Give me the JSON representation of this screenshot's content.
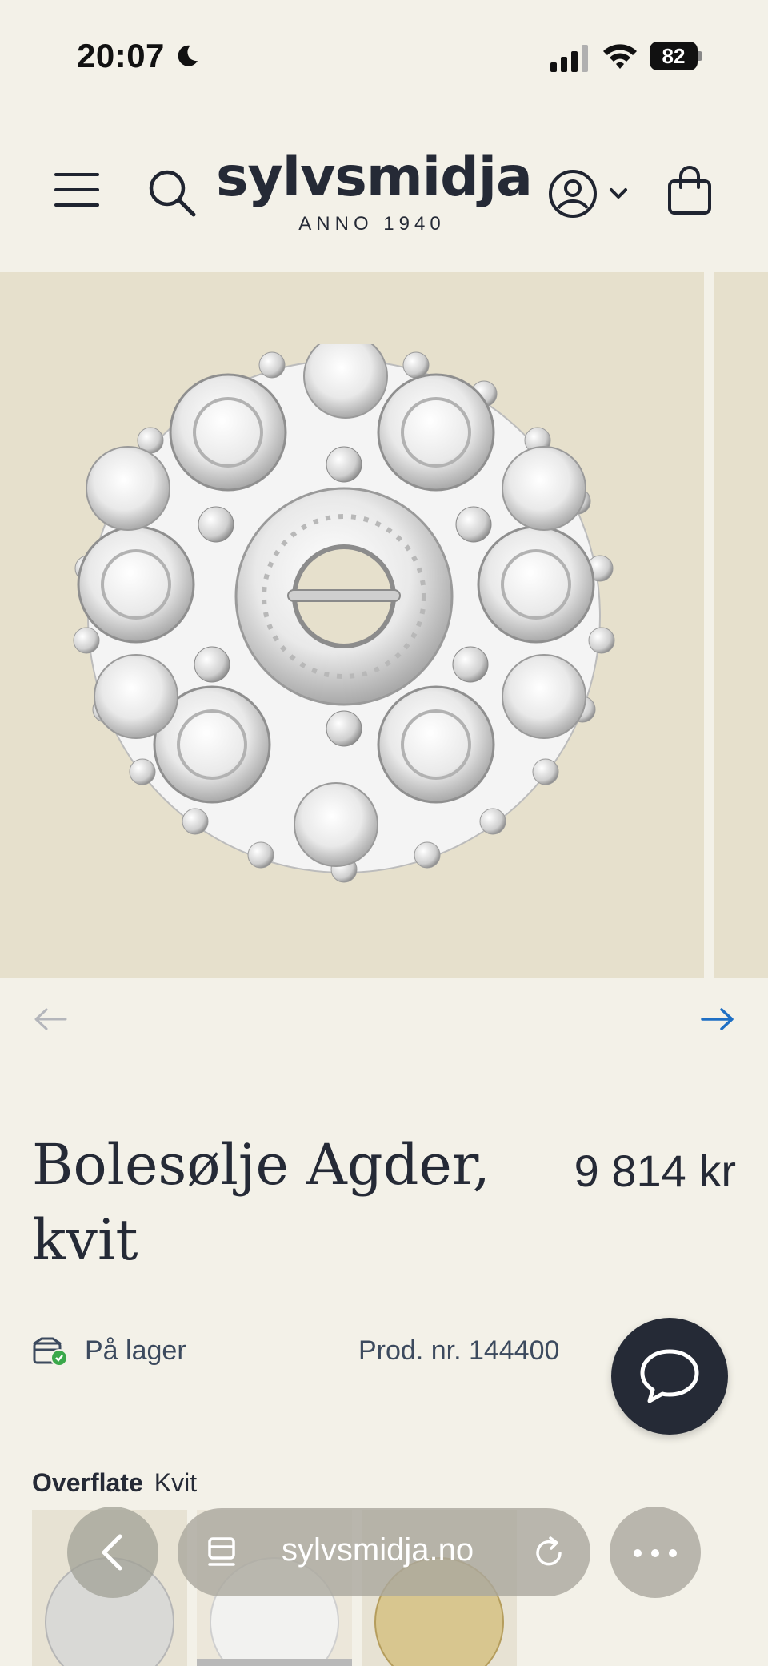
{
  "status_bar": {
    "time": "20:07",
    "battery": "82"
  },
  "header": {
    "logo_name": "sylvsmidja",
    "logo_sub": "ANNO 1940"
  },
  "product": {
    "title": "Bolesølje Agder, kvit",
    "price": "9 814 kr",
    "stock": "På lager",
    "product_number": "Prod. nr. 144400"
  },
  "options": {
    "label": "Overflate",
    "selected": "Kvit"
  },
  "browser": {
    "url": "sylvsmidja.no"
  },
  "colors": {
    "background": "#f3f1e8",
    "image_bg": "#e6e0cc",
    "text": "#252a36",
    "accent_arrow": "#1e6fc4",
    "stock_dot": "#3aa84a"
  }
}
